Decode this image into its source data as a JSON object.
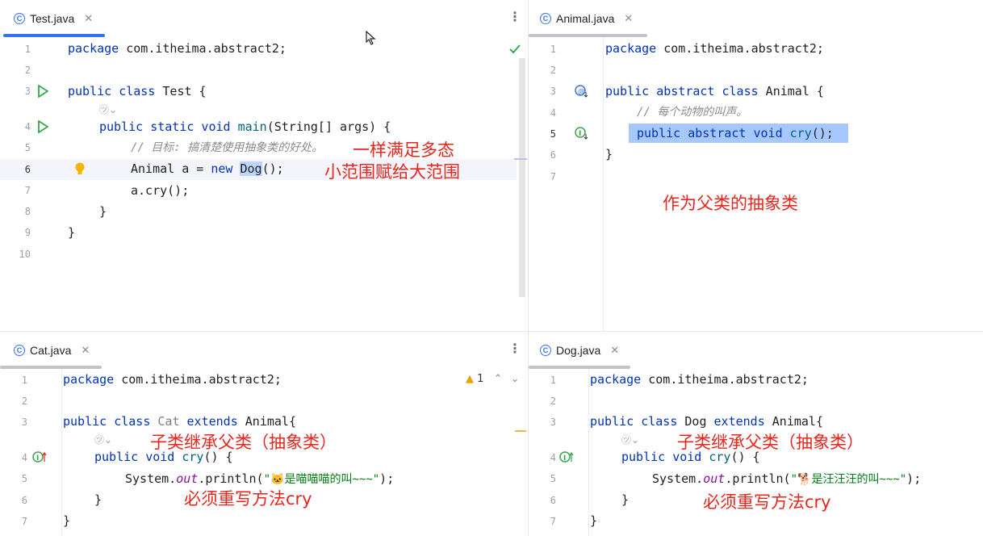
{
  "panes": {
    "test": {
      "tab_label": "Test.java",
      "lines": [
        "1",
        "2",
        "3",
        "4",
        "5",
        "6",
        "7",
        "8",
        "9",
        "10"
      ],
      "code": {
        "l1_kw": "package",
        "l1_rest": " com.itheima.abstract2;",
        "l3_kw": "public class",
        "l3_rest": " Test {",
        "l4_kw": "public static void",
        "l4_fn": "main",
        "l4_rest": "(String[] args) {",
        "l5_comment": "// 目标: 搞清楚使用抽象类的好处。",
        "l6_a": "Animal a = ",
        "l6_kw": "new",
        "l6_sel": "Dog",
        "l6_rest": "();",
        "l7": "a.cry();",
        "l8": "}",
        "l9": "}"
      },
      "annotations": [
        "一样满足多态",
        "小范围赋给大范围"
      ]
    },
    "animal": {
      "tab_label": "Animal.java",
      "lines": [
        "1",
        "2",
        "3",
        "4",
        "5",
        "6",
        "7"
      ],
      "code": {
        "l1_kw": "package",
        "l1_rest": " com.itheima.abstract2;",
        "l3_kw": "public abstract class",
        "l3_rest": " Animal {",
        "l4_comment": "// 每个动物的叫声。",
        "l5_kw": "public abstract void",
        "l5_fn": "cry",
        "l5_rest": "();",
        "l6": "}"
      },
      "annotations": [
        "作为父类的抽象类"
      ]
    },
    "cat": {
      "tab_label": "Cat.java",
      "lines": [
        "1",
        "2",
        "3",
        "4",
        "5",
        "6",
        "7"
      ],
      "warning_count": "1",
      "code": {
        "l1_kw": "package",
        "l1_rest": " com.itheima.abstract2;",
        "l3_kw": "public class",
        "l3_name": " Cat ",
        "l3_kw2": "extends",
        "l3_rest": " Animal{",
        "l4_kw": "public void",
        "l4_fn": "cry",
        "l4_rest": "() {",
        "l5_a": "System.",
        "l5_fld": "out",
        "l5_b": ".println(",
        "l5_str": "\"🐱是喵喵喵的叫~~~\"",
        "l5_c": ");",
        "l6": "}",
        "l7": "}"
      },
      "annotations": [
        "子类继承父类（抽象类）",
        "必须重写方法cry"
      ]
    },
    "dog": {
      "tab_label": "Dog.java",
      "lines": [
        "1",
        "2",
        "3",
        "4",
        "5",
        "6",
        "7"
      ],
      "code": {
        "l1_kw": "package",
        "l1_rest": " com.itheima.abstract2;",
        "l3_kw": "public class",
        "l3_name": " Dog ",
        "l3_kw2": "extends",
        "l3_rest": " Animal{",
        "l4_kw": "public void",
        "l4_fn": "cry",
        "l4_rest": "() {",
        "l5_a": "System.",
        "l5_fld": "out",
        "l5_b": ".println(",
        "l5_str": "\"🐕是汪汪汪的叫~~~\"",
        "l5_c": ");",
        "l6": "}",
        "l7": "}"
      },
      "annotations": [
        "子类继承父类（抽象类）",
        "必须重写方法cry"
      ]
    }
  },
  "colors": {
    "keyword": "#0033b3",
    "annotation": "#e8261d",
    "tab_active": "#3574f0",
    "selection": "#a6c8ff"
  },
  "icons": [
    "run-icon",
    "lightbulb-icon",
    "implementation-icon",
    "override-icon",
    "warning-icon",
    "class-icon",
    "close-icon",
    "more-icon"
  ]
}
